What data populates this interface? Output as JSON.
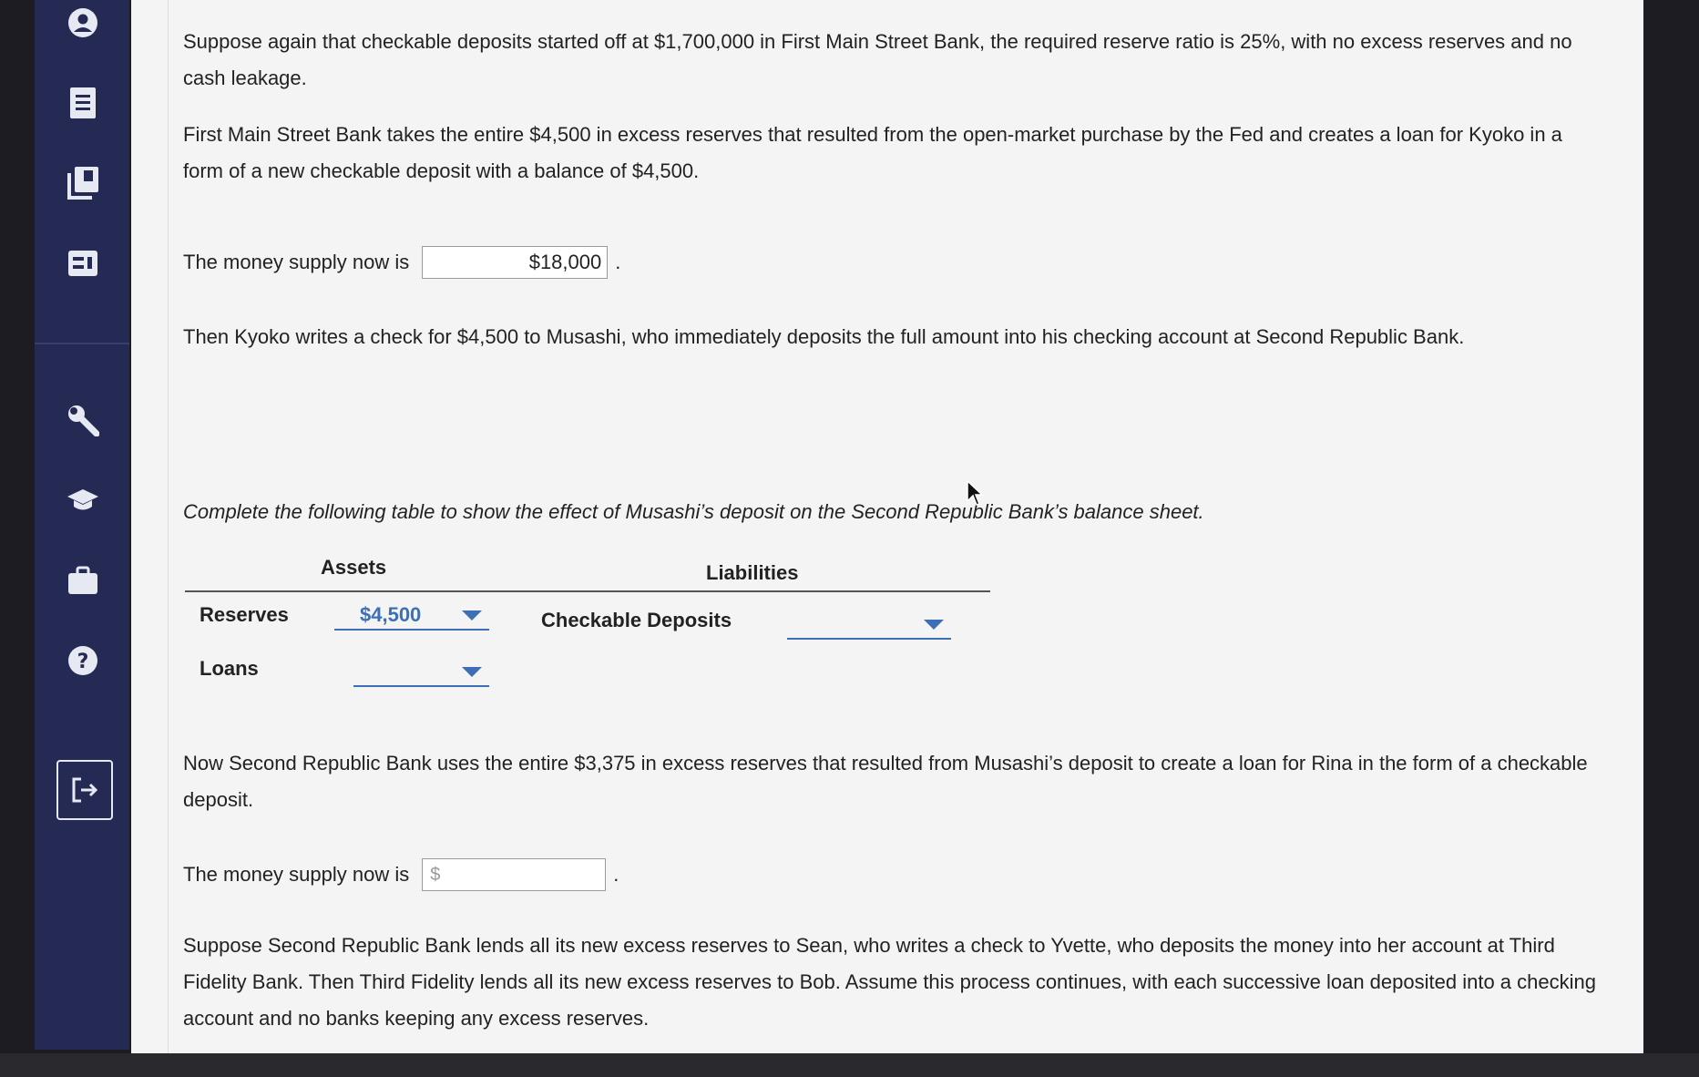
{
  "sidebar": {
    "icons": [
      "user-circle-icon",
      "document-list-icon",
      "library-books-icon",
      "calculator-icon",
      "wrench-icon",
      "graduation-cap-icon",
      "briefcase-icon",
      "help-icon",
      "exit-icon"
    ]
  },
  "question": {
    "intro": "Suppose again that checkable deposits started off at $1,700,000 in First Main Street Bank, the required reserve ratio is 25%, with no excess reserves and no cash leakage.",
    "loan_paragraph": "First Main Street Bank takes the entire $4,500 in excess reserves that resulted from the open-market purchase by the Fed and creates a loan for Kyoko in a form of a new checkable deposit with a balance of $4,500.",
    "money_supply_label_1": "The money supply now is",
    "money_supply_value_1": "$18,000",
    "check_paragraph": "Then Kyoko writes a check for $4,500 to Musashi, who immediately deposits the full amount into his checking account at Second Republic Bank.",
    "table_instruction": "Complete the following table to show the effect of Musashi’s deposit on the Second Republic Bank’s balance sheet.",
    "balance_sheet": {
      "assets_header": "Assets",
      "liabilities_header": "Liabilities",
      "reserves_label": "Reserves",
      "reserves_value": "$4,500",
      "loans_label": "Loans",
      "loans_value": "",
      "checkable_deposits_label": "Checkable Deposits",
      "checkable_deposits_value": ""
    },
    "second_loan_paragraph": "Now Second Republic Bank uses the entire $3,375 in excess reserves that resulted from Musashi’s deposit to create a loan for Rina in the form of a checkable deposit.",
    "money_supply_label_2": "The money supply now is",
    "money_supply_placeholder_2": "$",
    "final_paragraph": "Suppose Second Republic Bank lends all its new excess reserves to Sean, who writes a check to Yvette, who deposits the money into her account at Third Fidelity Bank. Then Third Fidelity lends all its new excess reserves to Bob. Assume this process continues, with each successive loan deposited into a checking account and no banks keeping any excess reserves.",
    "period": "."
  }
}
